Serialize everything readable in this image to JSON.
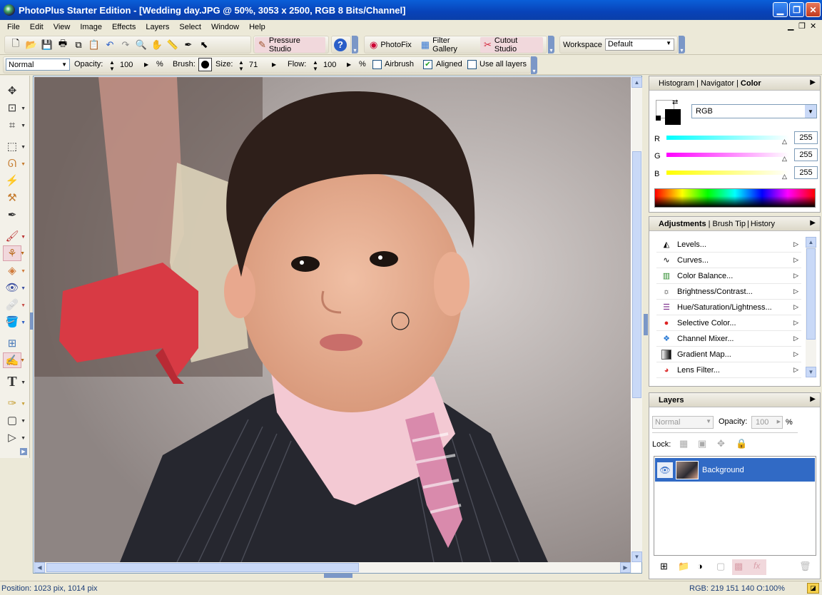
{
  "window": {
    "title": "PhotoPlus Starter Edition - [Wedding day.JPG @ 50%, 3053 x 2500, RGB 8 Bits/Channel]"
  },
  "menu": [
    "File",
    "Edit",
    "View",
    "Image",
    "Effects",
    "Layers",
    "Select",
    "Window",
    "Help"
  ],
  "toolbar": {
    "pressure_studio": "Pressure Studio",
    "photofix": "PhotoFix",
    "filter_gallery": "Filter Gallery",
    "cutout_studio": "Cutout Studio",
    "workspace_label": "Workspace",
    "workspace_value": "Default"
  },
  "options": {
    "blend_mode": "Normal",
    "opacity_label": "Opacity:",
    "opacity_value": "100",
    "opacity_unit": "%",
    "brush_label": "Brush:",
    "size_label": "Size:",
    "size_value": "71",
    "flow_label": "Flow:",
    "flow_value": "100",
    "flow_unit": "%",
    "airbrush": "Airbrush",
    "aligned": "Aligned",
    "use_all_layers": "Use all layers"
  },
  "color_panel": {
    "tabs": [
      "Histogram",
      "Navigator",
      "Color"
    ],
    "mode": "RGB",
    "r_label": "R",
    "g_label": "G",
    "b_label": "B",
    "r": "255",
    "g": "255",
    "b": "255"
  },
  "adjustments_panel": {
    "tabs": [
      "Adjustments",
      "Brush Tip",
      "History"
    ],
    "items": [
      "Levels...",
      "Curves...",
      "Color Balance...",
      "Brightness/Contrast...",
      "Hue/Saturation/Lightness...",
      "Selective Color...",
      "Channel Mixer...",
      "Gradient Map...",
      "Lens Filter..."
    ]
  },
  "layers_panel": {
    "title": "Layers",
    "blend_mode": "Normal",
    "opacity_label": "Opacity:",
    "opacity_value": "100",
    "opacity_unit": "%",
    "lock_label": "Lock:",
    "layer_name": "Background"
  },
  "status": {
    "position": "Position: 1023 pix, 1014 pix",
    "rgb": "RGB: 219 151 140 O:100%"
  },
  "colors": {
    "title_bar": "#0842b8",
    "layer_selected": "#316ac5"
  }
}
